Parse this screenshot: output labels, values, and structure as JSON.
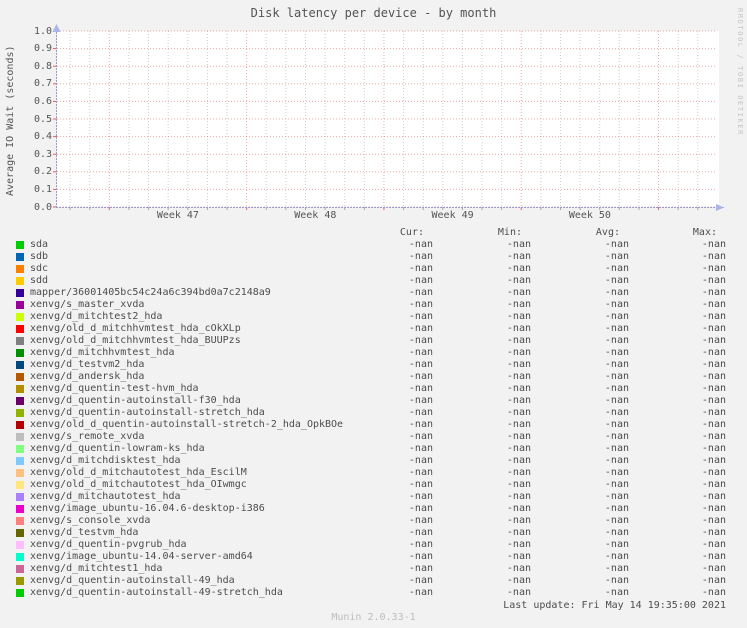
{
  "title": "Disk latency per device - by month",
  "watermark": "RRDTOOL / TOBI OETIKER",
  "y_axis_label": "Average IO Wait (seconds)",
  "legend": {
    "columns": [
      "Cur:",
      "Min:",
      "Avg:",
      "Max:"
    ],
    "rows": [
      {
        "label": "sda",
        "color": "#00CC00",
        "cur": "-nan",
        "min": "-nan",
        "avg": "-nan",
        "max": "-nan"
      },
      {
        "label": "sdb",
        "color": "#0066B3",
        "cur": "-nan",
        "min": "-nan",
        "avg": "-nan",
        "max": "-nan"
      },
      {
        "label": "sdc",
        "color": "#FF8000",
        "cur": "-nan",
        "min": "-nan",
        "avg": "-nan",
        "max": "-nan"
      },
      {
        "label": "sdd",
        "color": "#FFCC00",
        "cur": "-nan",
        "min": "-nan",
        "avg": "-nan",
        "max": "-nan"
      },
      {
        "label": "mapper/36001405bc54c24a6c394bd0a7c2148a9",
        "color": "#330099",
        "cur": "-nan",
        "min": "-nan",
        "avg": "-nan",
        "max": "-nan"
      },
      {
        "label": "xenvg/s_master_xvda",
        "color": "#990099",
        "cur": "-nan",
        "min": "-nan",
        "avg": "-nan",
        "max": "-nan"
      },
      {
        "label": "xenvg/d_mitchtest2_hda",
        "color": "#CCFF00",
        "cur": "-nan",
        "min": "-nan",
        "avg": "-nan",
        "max": "-nan"
      },
      {
        "label": "xenvg/old_d_mitchhvmtest_hda_cOkXLp",
        "color": "#FF0000",
        "cur": "-nan",
        "min": "-nan",
        "avg": "-nan",
        "max": "-nan"
      },
      {
        "label": "xenvg/old_d_mitchhvmtest_hda_BUUPzs",
        "color": "#808080",
        "cur": "-nan",
        "min": "-nan",
        "avg": "-nan",
        "max": "-nan"
      },
      {
        "label": "xenvg/d_mitchhvmtest_hda",
        "color": "#008F00",
        "cur": "-nan",
        "min": "-nan",
        "avg": "-nan",
        "max": "-nan"
      },
      {
        "label": "xenvg/d_testvm2_hda",
        "color": "#00487D",
        "cur": "-nan",
        "min": "-nan",
        "avg": "-nan",
        "max": "-nan"
      },
      {
        "label": "xenvg/d_andersk_hda",
        "color": "#B35A00",
        "cur": "-nan",
        "min": "-nan",
        "avg": "-nan",
        "max": "-nan"
      },
      {
        "label": "xenvg/d_quentin-test-hvm_hda",
        "color": "#B38F00",
        "cur": "-nan",
        "min": "-nan",
        "avg": "-nan",
        "max": "-nan"
      },
      {
        "label": "xenvg/d_quentin-autoinstall-f30_hda",
        "color": "#6B006B",
        "cur": "-nan",
        "min": "-nan",
        "avg": "-nan",
        "max": "-nan"
      },
      {
        "label": "xenvg/d_quentin-autoinstall-stretch_hda",
        "color": "#8FB300",
        "cur": "-nan",
        "min": "-nan",
        "avg": "-nan",
        "max": "-nan"
      },
      {
        "label": "xenvg/old_d_quentin-autoinstall-stretch-2_hda_OpkBOe",
        "color": "#B30000",
        "cur": "-nan",
        "min": "-nan",
        "avg": "-nan",
        "max": "-nan"
      },
      {
        "label": "xenvg/s_remote_xvda",
        "color": "#BEBEBE",
        "cur": "-nan",
        "min": "-nan",
        "avg": "-nan",
        "max": "-nan"
      },
      {
        "label": "xenvg/d_quentin-lowram-ks_hda",
        "color": "#80FF80",
        "cur": "-nan",
        "min": "-nan",
        "avg": "-nan",
        "max": "-nan"
      },
      {
        "label": "xenvg/d_mitchdisktest_hda",
        "color": "#80C9FF",
        "cur": "-nan",
        "min": "-nan",
        "avg": "-nan",
        "max": "-nan"
      },
      {
        "label": "xenvg/old_d_mitchautotest_hda_EscilM",
        "color": "#FFC080",
        "cur": "-nan",
        "min": "-nan",
        "avg": "-nan",
        "max": "-nan"
      },
      {
        "label": "xenvg/old_d_mitchautotest_hda_OIwmgc",
        "color": "#FFE680",
        "cur": "-nan",
        "min": "-nan",
        "avg": "-nan",
        "max": "-nan"
      },
      {
        "label": "xenvg/d_mitchautotest_hda",
        "color": "#AA80FF",
        "cur": "-nan",
        "min": "-nan",
        "avg": "-nan",
        "max": "-nan"
      },
      {
        "label": "xenvg/image_ubuntu-16.04.6-desktop-i386",
        "color": "#EE00CC",
        "cur": "-nan",
        "min": "-nan",
        "avg": "-nan",
        "max": "-nan"
      },
      {
        "label": "xenvg/s_console_xvda",
        "color": "#FF8080",
        "cur": "-nan",
        "min": "-nan",
        "avg": "-nan",
        "max": "-nan"
      },
      {
        "label": "xenvg/d_testvm_hda",
        "color": "#666600",
        "cur": "-nan",
        "min": "-nan",
        "avg": "-nan",
        "max": "-nan"
      },
      {
        "label": "xenvg/d_quentin-pvgrub_hda",
        "color": "#FFBFFF",
        "cur": "-nan",
        "min": "-nan",
        "avg": "-nan",
        "max": "-nan"
      },
      {
        "label": "xenvg/image_ubuntu-14.04-server-amd64",
        "color": "#00FFCC",
        "cur": "-nan",
        "min": "-nan",
        "avg": "-nan",
        "max": "-nan"
      },
      {
        "label": "xenvg/d_mitchtest1_hda",
        "color": "#CC6699",
        "cur": "-nan",
        "min": "-nan",
        "avg": "-nan",
        "max": "-nan"
      },
      {
        "label": "xenvg/d_quentin-autoinstall-49_hda",
        "color": "#999900",
        "cur": "-nan",
        "min": "-nan",
        "avg": "-nan",
        "max": "-nan"
      },
      {
        "label": "xenvg/d_quentin-autoinstall-49-stretch_hda",
        "color": "#00CC00",
        "cur": "-nan",
        "min": "-nan",
        "avg": "-nan",
        "max": "-nan"
      }
    ]
  },
  "footer": {
    "last_update": "Last update: Fri May 14 19:35:00 2021",
    "version": "Munin 2.0.33-1"
  },
  "chart_data": {
    "type": "line",
    "title": "Disk latency per device - by month",
    "xlabel": "",
    "ylabel": "Average IO Wait (seconds)",
    "ylim": [
      0.0,
      1.0
    ],
    "y_ticks": [
      0.0,
      0.1,
      0.2,
      0.3,
      0.4,
      0.5,
      0.6,
      0.7,
      0.8,
      0.9,
      1.0
    ],
    "x_tick_labels": [
      "Week 47",
      "Week 48",
      "Week 49",
      "Week 50"
    ],
    "grid": true,
    "legend_position": "bottom",
    "note": "No data points are plotted; every series value is -nan (empty canvas)",
    "series": [
      {
        "name": "sda",
        "color": "#00CC00",
        "values": []
      },
      {
        "name": "sdb",
        "color": "#0066B3",
        "values": []
      },
      {
        "name": "sdc",
        "color": "#FF8000",
        "values": []
      },
      {
        "name": "sdd",
        "color": "#FFCC00",
        "values": []
      },
      {
        "name": "mapper/36001405bc54c24a6c394bd0a7c2148a9",
        "color": "#330099",
        "values": []
      },
      {
        "name": "xenvg/s_master_xvda",
        "color": "#990099",
        "values": []
      },
      {
        "name": "xenvg/d_mitchtest2_hda",
        "color": "#CCFF00",
        "values": []
      },
      {
        "name": "xenvg/old_d_mitchhvmtest_hda_cOkXLp",
        "color": "#FF0000",
        "values": []
      },
      {
        "name": "xenvg/old_d_mitchhvmtest_hda_BUUPzs",
        "color": "#808080",
        "values": []
      },
      {
        "name": "xenvg/d_mitchhvmtest_hda",
        "color": "#008F00",
        "values": []
      },
      {
        "name": "xenvg/d_testvm2_hda",
        "color": "#00487D",
        "values": []
      },
      {
        "name": "xenvg/d_andersk_hda",
        "color": "#B35A00",
        "values": []
      },
      {
        "name": "xenvg/d_quentin-test-hvm_hda",
        "color": "#B38F00",
        "values": []
      },
      {
        "name": "xenvg/d_quentin-autoinstall-f30_hda",
        "color": "#6B006B",
        "values": []
      },
      {
        "name": "xenvg/d_quentin-autoinstall-stretch_hda",
        "color": "#8FB300",
        "values": []
      },
      {
        "name": "xenvg/old_d_quentin-autoinstall-stretch-2_hda_OpkBOe",
        "color": "#B30000",
        "values": []
      },
      {
        "name": "xenvg/s_remote_xvda",
        "color": "#BEBEBE",
        "values": []
      },
      {
        "name": "xenvg/d_quentin-lowram-ks_hda",
        "color": "#80FF80",
        "values": []
      },
      {
        "name": "xenvg/d_mitchdisktest_hda",
        "color": "#80C9FF",
        "values": []
      },
      {
        "name": "xenvg/old_d_mitchautotest_hda_EscilM",
        "color": "#FFC080",
        "values": []
      },
      {
        "name": "xenvg/old_d_mitchautotest_hda_OIwmgc",
        "color": "#FFE680",
        "values": []
      },
      {
        "name": "xenvg/d_mitchautotest_hda",
        "color": "#AA80FF",
        "values": []
      },
      {
        "name": "xenvg/image_ubuntu-16.04.6-desktop-i386",
        "color": "#EE00CC",
        "values": []
      },
      {
        "name": "xenvg/s_console_xvda",
        "color": "#FF8080",
        "values": []
      },
      {
        "name": "xenvg/d_testvm_hda",
        "color": "#666600",
        "values": []
      },
      {
        "name": "xenvg/d_quentin-pvgrub_hda",
        "color": "#FFBFFF",
        "values": []
      },
      {
        "name": "xenvg/image_ubuntu-14.04-server-amd64",
        "color": "#00FFCC",
        "values": []
      },
      {
        "name": "xenvg/d_mitchtest1_hda",
        "color": "#CC6699",
        "values": []
      },
      {
        "name": "xenvg/d_quentin-autoinstall-49_hda",
        "color": "#999900",
        "values": []
      },
      {
        "name": "xenvg/d_quentin-autoinstall-49-stretch_hda",
        "color": "#00CC00",
        "values": []
      }
    ]
  }
}
